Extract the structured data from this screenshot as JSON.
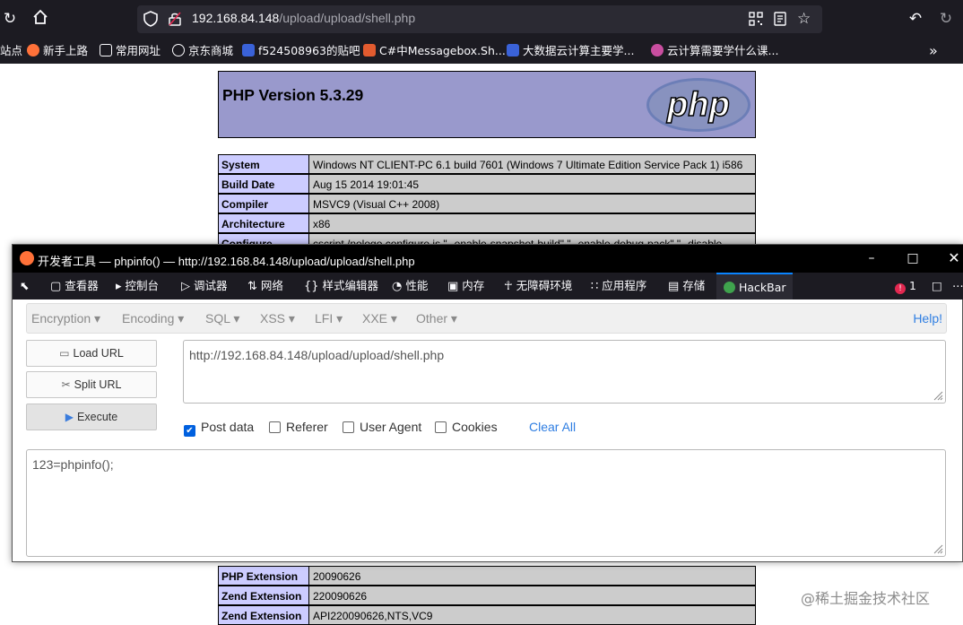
{
  "browser": {
    "url_host": "192.168.84.148",
    "url_path": "/upload/upload/shell.php",
    "bookmarks": [
      "站点",
      "新手上路",
      "常用网址",
      "京东商城",
      "f524508963的贴吧",
      "C#中Messagebox.Sh...",
      "大数据云计算主要学...",
      "云计算需要学什么课..."
    ]
  },
  "phpinfo": {
    "version_title": "PHP Version 5.3.29",
    "logo_text": "php",
    "rows_top": [
      {
        "key": "System",
        "value": "Windows NT CLIENT-PC 6.1 build 7601 (Windows 7 Ultimate Edition Service Pack 1) i586"
      },
      {
        "key": "Build Date",
        "value": "Aug 15 2014 19:01:45"
      },
      {
        "key": "Compiler",
        "value": "MSVC9 (Visual C++ 2008)"
      },
      {
        "key": "Architecture",
        "value": "x86"
      },
      {
        "key": "Configure",
        "value": "cscript /nologo configure.js \"--enable-snapshot-build\" \"--enable-debug-pack\" \"--disable-"
      }
    ],
    "rows_bottom": [
      {
        "key": "PHP Extension",
        "value": "20090626"
      },
      {
        "key": "Zend Extension",
        "value": "220090626"
      },
      {
        "key": "Zend Extension",
        "value": "API220090626,NTS,VC9"
      }
    ]
  },
  "devtools": {
    "title": "开发者工具 — phpinfo() — http://192.168.84.148/upload/upload/shell.php",
    "tabs": [
      "查看器",
      "控制台",
      "调试器",
      "网络",
      "样式编辑器",
      "性能",
      "内存",
      "无障碍环境",
      "应用程序",
      "存储",
      "HackBar"
    ],
    "error_count": "1"
  },
  "hackbar": {
    "menu": [
      "Encryption",
      "Encoding",
      "SQL",
      "XSS",
      "LFI",
      "XXE",
      "Other"
    ],
    "help": "Help!",
    "load_url": "Load URL",
    "split_url": "Split URL",
    "execute": "Execute",
    "url_value": "http://192.168.84.148/upload/upload/shell.php",
    "options": {
      "post_data": "Post data",
      "referer": "Referer",
      "user_agent": "User Agent",
      "cookies": "Cookies",
      "post_checked": true
    },
    "clear_all": "Clear All",
    "post_value": "123=phpinfo();"
  },
  "watermark": "@稀土掘金技术社区"
}
